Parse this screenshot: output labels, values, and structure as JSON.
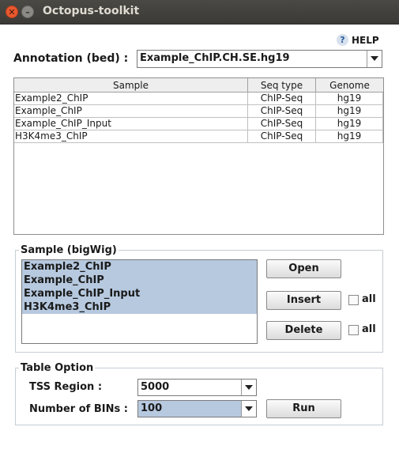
{
  "window": {
    "title": "Octopus-toolkit"
  },
  "help": {
    "icon_glyph": "?",
    "label": "HELP"
  },
  "annotation": {
    "label": "Annotation (bed) :",
    "value": "Example_ChIP.CH.SE.hg19"
  },
  "sample_table": {
    "headers": [
      "Sample",
      "Seq type",
      "Genome"
    ],
    "rows": [
      [
        "Example2_ChIP",
        "ChIP-Seq",
        "hg19"
      ],
      [
        "Example_ChIP",
        "ChIP-Seq",
        "hg19"
      ],
      [
        "Example_ChIP_Input",
        "ChIP-Seq",
        "hg19"
      ],
      [
        "H3K4me3_ChIP",
        "ChIP-Seq",
        "hg19"
      ]
    ]
  },
  "bigwig": {
    "legend": "Sample (bigWig)",
    "items": [
      "Example2_ChIP",
      "Example_ChIP",
      "Example_ChIP_Input",
      "H3K4me3_ChIP"
    ],
    "open_label": "Open",
    "insert_label": "Insert",
    "delete_label": "Delete",
    "all_label": "all",
    "insert_all_checked": false,
    "delete_all_checked": false
  },
  "table_option": {
    "legend": "Table Option",
    "tss_label": "TSS Region :",
    "tss_value": "5000",
    "bins_label": "Number of BINs :",
    "bins_value": "100",
    "run_label": "Run"
  },
  "colors": {
    "titlebar": "#3c3b37",
    "selection": "#b6c9df",
    "close": "#e9582f"
  }
}
